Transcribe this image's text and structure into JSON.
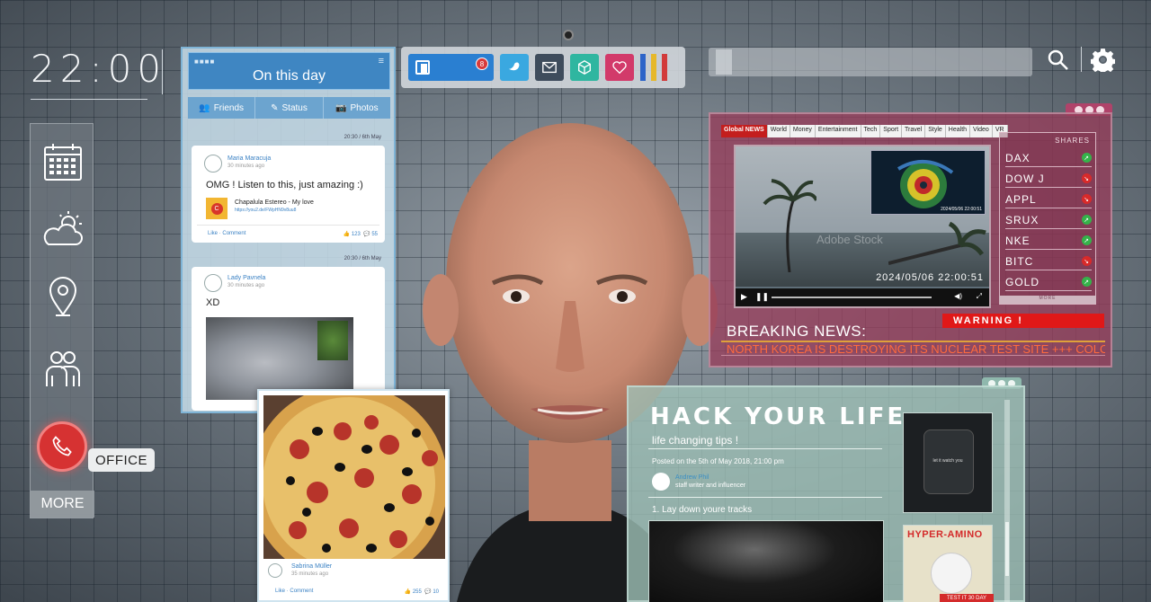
{
  "clock": {
    "time": "22:00"
  },
  "sidebar": {
    "items": [
      {
        "name": "calendar-icon"
      },
      {
        "name": "weather-icon"
      },
      {
        "name": "location-icon"
      },
      {
        "name": "contacts-icon"
      }
    ],
    "call_tooltip": "OFFICE",
    "more_label": "MORE"
  },
  "social": {
    "title": "On this day",
    "tabs": [
      {
        "label": "Friends",
        "icon": "friends-icon"
      },
      {
        "label": "Status",
        "icon": "edit-icon"
      },
      {
        "label": "Photos",
        "icon": "camera-icon"
      }
    ],
    "posts": [
      {
        "time": "20:30 / 6th  May",
        "author": "Maria Maracuja",
        "ago": "30 minutes ago",
        "text": "OMG ! Listen to this,  just amazing :)",
        "link_title": "Chapalula Estereo -  My love",
        "link_url": "https://you2.de/FWpHN9v8uu8",
        "like": "Like",
        "comment": "Comment",
        "likes": "123",
        "comments": "55"
      },
      {
        "time": "20:30 / 6th  May",
        "author": "Lady Pavnela",
        "ago": "30 minutes ago",
        "text": "XD"
      }
    ]
  },
  "pizza_post": {
    "author": "Sabrina Müller",
    "ago": "35 minutes ago",
    "like": "Like",
    "comment": "Comment",
    "likes": "255",
    "comments": "10"
  },
  "toolbar": {
    "apps": [
      {
        "name": "social-app-icon",
        "badge": "8",
        "color": "#2a7fd1"
      },
      {
        "name": "bird-app-icon",
        "color": "#3aa8e0"
      },
      {
        "name": "mail-app-icon",
        "color": "#3e4c5c"
      },
      {
        "name": "box-app-icon",
        "color": "#2fb6a0"
      },
      {
        "name": "heart-app-icon",
        "color": "#d23a6a"
      }
    ]
  },
  "news": {
    "nav": [
      "Global NEWS",
      "World",
      "Money",
      "Entertainment",
      "Tech",
      "Sport",
      "Travel",
      "Style",
      "Health",
      "Video",
      "VR"
    ],
    "video_timestamp": "2024/05/06    22:00:51",
    "radar_timestamp": "2024/05/06    22:00:51",
    "watermark": "Adobe Stock",
    "shares_title": "SHARES",
    "shares": [
      {
        "symbol": "DAX",
        "trend": "up"
      },
      {
        "symbol": "DOW J",
        "trend": "down"
      },
      {
        "symbol": "APPL",
        "trend": "down"
      },
      {
        "symbol": "SRUX",
        "trend": "up"
      },
      {
        "symbol": "NKE",
        "trend": "up"
      },
      {
        "symbol": "BITC",
        "trend": "down"
      },
      {
        "symbol": "GOLD",
        "trend": "up"
      }
    ],
    "shares_more": "MORE",
    "breaking": "BREAKING NEWS:",
    "warning": "WARNING !",
    "ticker": "NORTH KOREA IS DESTROYING ITS NUCLEAR TEST SITE +++ COLO"
  },
  "hack": {
    "title": "HACK YOUR LIFE",
    "subtitle": "life changing tips !",
    "posted": "Posted on the 5th of May 2018, 21:00 pm",
    "author": "Andrew Phil",
    "role": "staff writer and influencer",
    "tip": "1. Lay down youre tracks",
    "ad_watch_text": "let it watch you",
    "ad_amino_title": "HYPER-AMINO",
    "ad_amino_cta": "TEST IT 30 DAY"
  },
  "colors": {
    "accent_blue": "#3f86c2",
    "news_panel": "#963c5a",
    "alert_red": "#e01818",
    "trend_up": "#35b24a",
    "trend_down": "#d82a2a",
    "hack_panel": "#a0c3b9"
  }
}
